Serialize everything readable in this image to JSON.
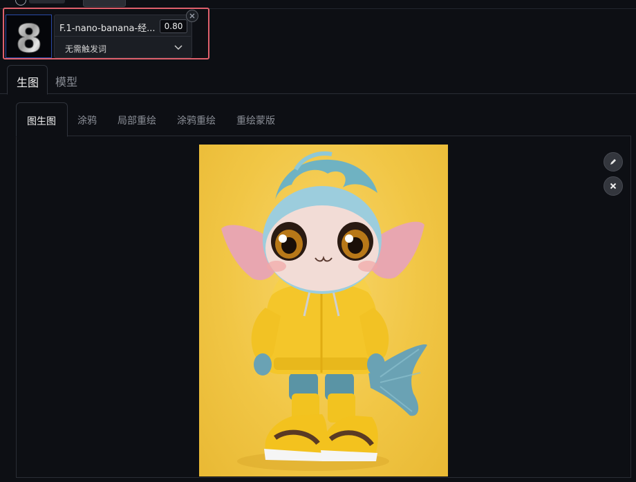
{
  "lora_card": {
    "thumbnail_char": "8",
    "name": "F.1-nano-banana-经...",
    "weight": "0.80",
    "trigger_select_value": "无需触发词"
  },
  "main_tabs": [
    {
      "label": "生图",
      "active": true
    },
    {
      "label": "模型",
      "active": false
    }
  ],
  "sub_tabs": [
    {
      "label": "图生图",
      "active": true
    },
    {
      "label": "涂鸦",
      "active": false
    },
    {
      "label": "局部重绘",
      "active": false
    },
    {
      "label": "涂鸦重绘",
      "active": false
    },
    {
      "label": "重绘蒙版",
      "active": false
    }
  ],
  "image_toolbar": {
    "edit_icon": "pencil-icon",
    "clear_icon": "close-icon"
  },
  "colors": {
    "highlight_border": "#e0606c",
    "background": "#0d0f14",
    "image_background": "#f1c645"
  }
}
